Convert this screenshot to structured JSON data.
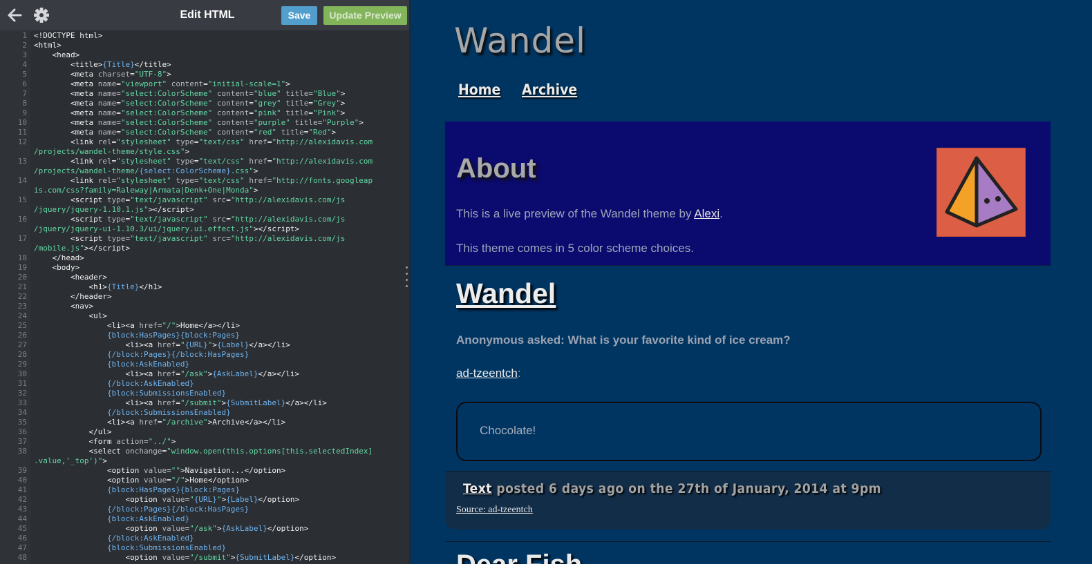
{
  "toolbar": {
    "title": "Edit HTML",
    "save_label": "Save",
    "update_label": "Update Preview",
    "back_icon": "arrow-left-icon",
    "settings_icon": "gear-icon"
  },
  "code_lines": [
    {
      "n": "1",
      "h": "&lt;!DOCTYPE html&gt;"
    },
    {
      "n": "2",
      "h": "&lt;html&gt;"
    },
    {
      "n": "3",
      "h": "    &lt;head&gt;"
    },
    {
      "n": "4",
      "h": "        &lt;title&gt;<span class=\"tv\">{Title}</span>&lt;/title&gt;"
    },
    {
      "n": "5",
      "h": "        &lt;meta <span class=\"at\">charset</span>=<span class=\"s\">\"UTF-8\"</span>&gt;"
    },
    {
      "n": "6",
      "h": "        &lt;meta <span class=\"at\">name</span>=<span class=\"s\">\"viewport\"</span> <span class=\"at\">content</span>=<span class=\"s\">\"initial-scale=1\"</span>&gt;"
    },
    {
      "n": "7",
      "h": "        &lt;meta <span class=\"at\">name</span>=<span class=\"s\">\"select:ColorScheme\"</span> <span class=\"at\">content</span>=<span class=\"s\">\"blue\"</span> <span class=\"at\">title</span>=<span class=\"s\">\"Blue\"</span>&gt;"
    },
    {
      "n": "8",
      "h": "        &lt;meta <span class=\"at\">name</span>=<span class=\"s\">\"select:ColorScheme\"</span> <span class=\"at\">content</span>=<span class=\"s\">\"grey\"</span> <span class=\"at\">title</span>=<span class=\"s\">\"Grey\"</span>&gt;"
    },
    {
      "n": "9",
      "h": "        &lt;meta <span class=\"at\">name</span>=<span class=\"s\">\"select:ColorScheme\"</span> <span class=\"at\">content</span>=<span class=\"s\">\"pink\"</span> <span class=\"at\">title</span>=<span class=\"s\">\"Pink\"</span>&gt;"
    },
    {
      "n": "10",
      "h": "        &lt;meta <span class=\"at\">name</span>=<span class=\"s\">\"select:ColorScheme\"</span> <span class=\"at\">content</span>=<span class=\"s\">\"purple\"</span> <span class=\"at\">title</span>=<span class=\"s\">\"Purple\"</span>&gt;"
    },
    {
      "n": "11",
      "h": "        &lt;meta <span class=\"at\">name</span>=<span class=\"s\">\"select:ColorScheme\"</span> <span class=\"at\">content</span>=<span class=\"s\">\"red\"</span> <span class=\"at\">title</span>=<span class=\"s\">\"Red\"</span>&gt;"
    },
    {
      "n": "12",
      "h": "        &lt;link <span class=\"at\">rel</span>=<span class=\"s\">\"stylesheet\"</span> <span class=\"at\">type</span>=<span class=\"s\">\"text/css\"</span> <span class=\"at\">href</span>=<span class=\"s\">\"http://alexidavis.com</span>",
      "c": "/projects/wandel-theme/style.css\"<span style=\"color:#f2f2f2\">&gt;</span>"
    },
    {
      "n": "13",
      "h": "        &lt;link <span class=\"at\">rel</span>=<span class=\"s\">\"stylesheet\"</span> <span class=\"at\">type</span>=<span class=\"s\">\"text/css\"</span> <span class=\"at\">href</span>=<span class=\"s\">\"http://alexidavis.com</span>",
      "c": "/projects/wandel-theme/<span class=\"tv\">{select:ColorScheme}</span>.css\"<span style=\"color:#f2f2f2\">&gt;</span>"
    },
    {
      "n": "14",
      "h": "        &lt;link <span class=\"at\">rel</span>=<span class=\"s\">\"stylesheet\"</span> <span class=\"at\">type</span>=<span class=\"s\">\"text/css\"</span> <span class=\"at\">href</span>=<span class=\"s\">\"http://fonts.googleap</span>",
      "c": "is.com/css?family=Raleway|Armata|Denk+One|Monda\"<span style=\"color:#f2f2f2\">&gt;</span>"
    },
    {
      "n": "15",
      "h": "        &lt;script <span class=\"at\">type</span>=<span class=\"s\">\"text/javascript\"</span> <span class=\"at\">src</span>=<span class=\"s\">\"http://alexidavis.com/js</span>",
      "c": "/jquery/jquery-1.10.1.js\"<span style=\"color:#f2f2f2\">&gt;&lt;/script&gt;</span>"
    },
    {
      "n": "16",
      "h": "        &lt;script <span class=\"at\">type</span>=<span class=\"s\">\"text/javascript\"</span> <span class=\"at\">src</span>=<span class=\"s\">\"http://alexidavis.com/js</span>",
      "c": "/jquery/jquery-ui-1.10.3/ui/jquery.ui.effect.js\"<span style=\"color:#f2f2f2\">&gt;&lt;/script&gt;</span>"
    },
    {
      "n": "17",
      "h": "        &lt;script <span class=\"at\">type</span>=<span class=\"s\">\"text/javascript\"</span> <span class=\"at\">src</span>=<span class=\"s\">\"http://alexidavis.com/js</span>",
      "c": "/mobile.js\"<span style=\"color:#f2f2f2\">&gt;&lt;/script&gt;</span>"
    },
    {
      "n": "18",
      "h": "    &lt;/head&gt;"
    },
    {
      "n": "19",
      "h": "    &lt;body&gt;"
    },
    {
      "n": "20",
      "h": "        &lt;header&gt;"
    },
    {
      "n": "21",
      "h": "            &lt;h1&gt;<span class=\"tv\">{Title}</span>&lt;/h1&gt;"
    },
    {
      "n": "22",
      "h": "        &lt;/header&gt;"
    },
    {
      "n": "23",
      "h": "        &lt;nav&gt;"
    },
    {
      "n": "24",
      "h": "            &lt;ul&gt;"
    },
    {
      "n": "25",
      "h": "                &lt;li&gt;&lt;a <span class=\"at\">href</span>=<span class=\"s\">\"/\"</span>&gt;Home&lt;/a&gt;&lt;/li&gt;"
    },
    {
      "n": "26",
      "h": "                <span class=\"tv\">{block:HasPages}{block:Pages}</span>"
    },
    {
      "n": "27",
      "h": "                    &lt;li&gt;&lt;a <span class=\"at\">href</span>=<span class=\"s\">\"<span class=\"tv\">{URL}</span>\"</span>&gt;<span class=\"tv\">{Label}</span>&lt;/a&gt;&lt;/li&gt;"
    },
    {
      "n": "28",
      "h": "                <span class=\"tv\">{/block:Pages}{/block:HasPages}</span>"
    },
    {
      "n": "29",
      "h": "                <span class=\"tv\">{block:AskEnabled}</span>"
    },
    {
      "n": "30",
      "h": "                    &lt;li&gt;&lt;a <span class=\"at\">href</span>=<span class=\"s\">\"/ask\"</span>&gt;<span class=\"tv\">{AskLabel}</span>&lt;/a&gt;&lt;/li&gt;"
    },
    {
      "n": "31",
      "h": "                <span class=\"tv\">{/block:AskEnabled}</span>"
    },
    {
      "n": "32",
      "h": "                <span class=\"tv\">{block:SubmissionsEnabled}</span>"
    },
    {
      "n": "33",
      "h": "                    &lt;li&gt;&lt;a <span class=\"at\">href</span>=<span class=\"s\">\"/submit\"</span>&gt;<span class=\"tv\">{SubmitLabel}</span>&lt;/a&gt;&lt;/li&gt;"
    },
    {
      "n": "34",
      "h": "                <span class=\"tv\">{/block:SubmissionsEnabled}</span>"
    },
    {
      "n": "35",
      "h": "                &lt;li&gt;&lt;a <span class=\"at\">href</span>=<span class=\"s\">\"/archive\"</span>&gt;Archive&lt;/a&gt;&lt;/li&gt;"
    },
    {
      "n": "36",
      "h": "            &lt;/ul&gt;"
    },
    {
      "n": "37",
      "h": "            &lt;form <span class=\"at\">action</span>=<span class=\"s\">\"../\"</span>&gt;"
    },
    {
      "n": "38",
      "h": "            &lt;select <span class=\"at\">onchange</span>=<span class=\"s\">\"window.open(this.options[this.selectedIndex]</span>",
      "c": ".value,'_top')\"<span style=\"color:#f2f2f2\">&gt;</span>"
    },
    {
      "n": "39",
      "h": "                &lt;option <span class=\"at\">value</span>=<span class=\"s\">\"\"</span>&gt;Navigation...&lt;/option&gt;"
    },
    {
      "n": "40",
      "h": "                &lt;option <span class=\"at\">value</span>=<span class=\"s\">\"/\"</span>&gt;Home&lt;/option&gt;"
    },
    {
      "n": "41",
      "h": "                <span class=\"tv\">{block:HasPages}{block:Pages}</span>"
    },
    {
      "n": "42",
      "h": "                    &lt;option <span class=\"at\">value</span>=<span class=\"s\">\"<span class=\"tv\">{URL}</span>\"</span>&gt;<span class=\"tv\">{Label}</span>&lt;/option&gt;"
    },
    {
      "n": "43",
      "h": "                <span class=\"tv\">{/block:Pages}{/block:HasPages}</span>"
    },
    {
      "n": "44",
      "h": "                <span class=\"tv\">{block:AskEnabled}</span>"
    },
    {
      "n": "45",
      "h": "                    &lt;option <span class=\"at\">value</span>=<span class=\"s\">\"/ask\"</span>&gt;<span class=\"tv\">{AskLabel}</span>&lt;/option&gt;"
    },
    {
      "n": "46",
      "h": "                <span class=\"tv\">{/block:AskEnabled}</span>"
    },
    {
      "n": "47",
      "h": "                <span class=\"tv\">{block:SubmissionsEnabled}</span>"
    },
    {
      "n": "48",
      "h": "                    &lt;option <span class=\"at\">value</span>=<span class=\"s\">\"/submit\"</span>&gt;<span class=\"tv\">{SubmitLabel}</span>&lt;/option&gt;"
    }
  ],
  "preview": {
    "blog_title": "Wandel",
    "nav": [
      "Home",
      "Archive"
    ],
    "about": {
      "title": "About",
      "text_before": "This is a live preview of the Wandel theme by ",
      "author_link": "Alexi",
      "text_after": ".",
      "line2": "This theme comes in 5 color scheme choices.",
      "avatar_color": "#dc5e44"
    },
    "post": {
      "title": "Wandel",
      "asked": "Anonymous asked: What is your favorite kind of ice cream?",
      "answerer": "ad-tzeentch",
      "answerer_colon": ":",
      "answer": "Chocolate!",
      "footer_type": "Text",
      "footer_rest": " posted 6 days ago on the 27th of January, 2014 at 9pm",
      "source": "Source: ad-tzeentch"
    },
    "next_post_title": "Dear Fish"
  }
}
